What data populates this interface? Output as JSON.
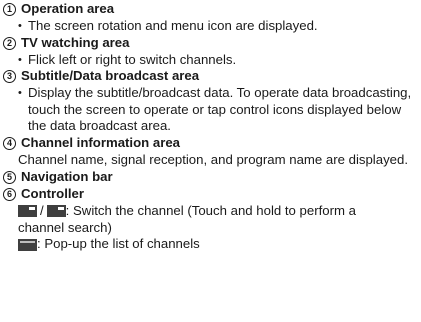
{
  "items": [
    {
      "num": "1",
      "title": "Operation area",
      "bullets": [
        "The screen rotation and menu icon are displayed."
      ]
    },
    {
      "num": "2",
      "title": "TV watching area",
      "bullets": [
        "Flick left or right to switch channels."
      ]
    },
    {
      "num": "3",
      "title": "Subtitle/Data broadcast area",
      "bullets": [
        "Display the subtitle/broadcast data. To operate data broadcasting, touch the screen to operate or tap control icons displayed below the data broadcast area."
      ]
    },
    {
      "num": "4",
      "title": "Channel information area",
      "text": "Channel name, signal reception, and program name are displayed."
    },
    {
      "num": "5",
      "title": "Navigation bar"
    },
    {
      "num": "6",
      "title": "Controller"
    }
  ],
  "controller": {
    "switch_text_1": ": Switch the channel (Touch and hold to perform a",
    "switch_text_2": "channel search)",
    "slash": "/",
    "list_text": ": Pop-up the list of channels",
    "icons": [
      "channel-prev-icon",
      "channel-next-icon",
      "channel-list-icon"
    ]
  }
}
